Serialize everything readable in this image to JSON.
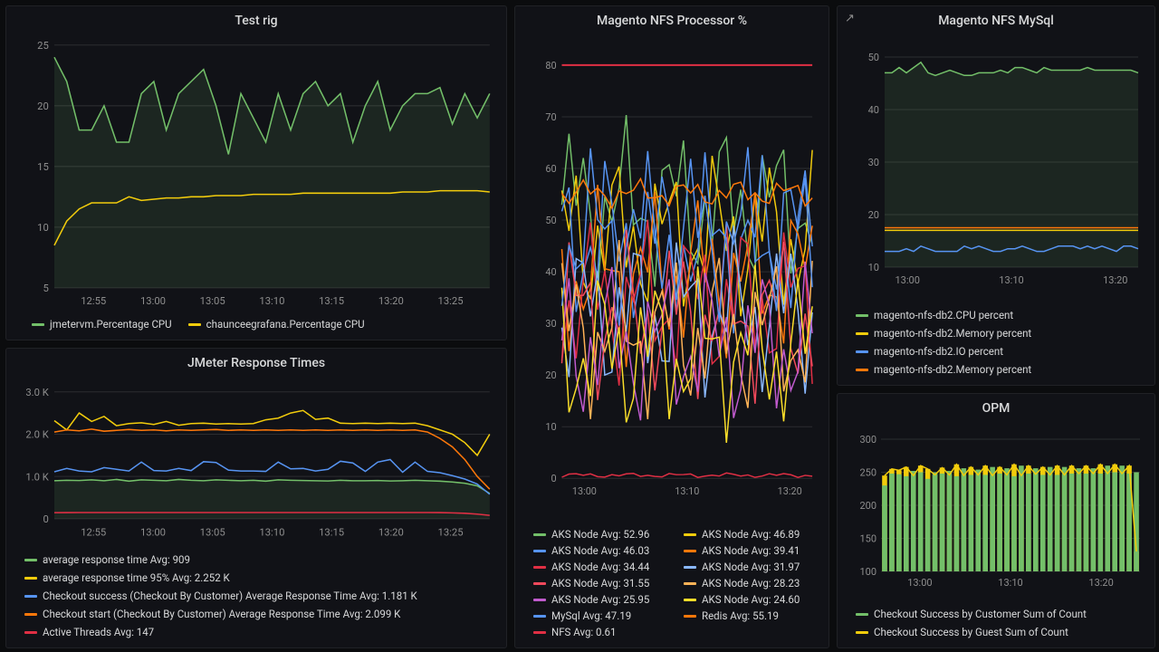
{
  "panels": {
    "testrig": {
      "title": "Test rig",
      "legend": [
        {
          "color": "#73bf69",
          "label": "jmetervm.Percentage CPU"
        },
        {
          "color": "#f2cc0c",
          "label": "chaunceegrafana.Percentage CPU"
        }
      ]
    },
    "jmeter": {
      "title": "JMeter Response Times",
      "legend": [
        {
          "color": "#73bf69",
          "label": "average response time  Avg: 909"
        },
        {
          "color": "#f2cc0c",
          "label": "average response time 95%  Avg: 2.252 K"
        },
        {
          "color": "#5794f2",
          "label": "Checkout success (Checkout By Customer) Average Response Time  Avg: 1.181 K"
        },
        {
          "color": "#ff780a",
          "label": "Checkout start (Checkout By Customer) Average Response Time  Avg: 2.099 K"
        },
        {
          "color": "#e02f44",
          "label": "Active Threads  Avg: 147"
        }
      ]
    },
    "nfsproc": {
      "title": "Magento NFS Processor %",
      "legend": [
        {
          "color": "#73bf69",
          "label": "AKS Node  Avg: 52.96"
        },
        {
          "color": "#f2cc0c",
          "label": "AKS Node  Avg: 46.89"
        },
        {
          "color": "#5794f2",
          "label": "AKS Node  Avg: 46.03"
        },
        {
          "color": "#ff780a",
          "label": "AKS Node  Avg: 39.41"
        },
        {
          "color": "#e02f44",
          "label": "AKS Node  Avg: 34.44"
        },
        {
          "color": "#8ab8ff",
          "label": "AKS Node  Avg: 31.97"
        },
        {
          "color": "#f2495c",
          "label": "AKS Node  Avg: 31.55"
        },
        {
          "color": "#ffb357",
          "label": "AKS Node  Avg: 28.23"
        },
        {
          "color": "#c15bce",
          "label": "AKS Node  Avg: 25.95"
        },
        {
          "color": "#fade2a",
          "label": "AKS Node  Avg: 24.60"
        },
        {
          "color": "#5794f2",
          "label": "MySql  Avg: 47.19"
        },
        {
          "color": "#ff780a",
          "label": "Redis  Avg: 55.19"
        },
        {
          "color": "#e02f44",
          "label": "NFS  Avg: 0.61"
        }
      ]
    },
    "mysql": {
      "title": "Magento NFS MySql",
      "legend": [
        {
          "color": "#73bf69",
          "label": "magento-nfs-db2.CPU percent"
        },
        {
          "color": "#f2cc0c",
          "label": "magento-nfs-db2.Memory percent"
        },
        {
          "color": "#5794f2",
          "label": "magento-nfs-db2.IO percent"
        },
        {
          "color": "#ff780a",
          "label": "magento-nfs-db2.Memory percent"
        }
      ]
    },
    "opm": {
      "title": "OPM",
      "legend": [
        {
          "color": "#73bf69",
          "label": "Checkout Success by Customer Sum of Count"
        },
        {
          "color": "#f2cc0c",
          "label": "Checkout Success by Guest Sum of Count"
        }
      ]
    }
  },
  "chart_data": [
    {
      "panel": "testrig",
      "type": "line",
      "x_ticks": [
        "12:55",
        "13:00",
        "13:05",
        "13:10",
        "13:15",
        "13:20",
        "13:25"
      ],
      "ylim": [
        5,
        25
      ],
      "y_ticks": [
        5,
        10,
        15,
        20,
        25
      ],
      "series": [
        {
          "name": "jmetervm.Percentage CPU",
          "color": "#73bf69",
          "x": [
            "12:50",
            "12:51",
            "12:52",
            "12:53",
            "12:54",
            "12:55",
            "12:56",
            "12:57",
            "12:58",
            "12:59",
            "13:00",
            "13:01",
            "13:02",
            "13:03",
            "13:04",
            "13:05",
            "13:06",
            "13:07",
            "13:08",
            "13:09",
            "13:10",
            "13:11",
            "13:12",
            "13:13",
            "13:14",
            "13:15",
            "13:16",
            "13:17",
            "13:18",
            "13:19",
            "13:20",
            "13:21",
            "13:22",
            "13:23",
            "13:24",
            "13:25"
          ],
          "y": [
            24,
            22,
            18,
            18,
            20,
            17,
            17,
            21,
            22,
            18,
            21,
            22,
            23,
            20,
            16,
            21,
            19,
            17,
            21,
            18,
            21,
            22,
            20,
            21,
            17,
            20,
            22,
            18,
            20,
            21,
            21,
            21.5,
            18.5,
            21,
            19,
            21
          ]
        },
        {
          "name": "chaunceegrafana.Percentage CPU",
          "color": "#f2cc0c",
          "x": [
            "12:50",
            "12:51",
            "12:52",
            "12:53",
            "12:54",
            "12:55",
            "12:56",
            "12:57",
            "12:58",
            "12:59",
            "13:00",
            "13:01",
            "13:02",
            "13:03",
            "13:04",
            "13:05",
            "13:06",
            "13:07",
            "13:08",
            "13:09",
            "13:10",
            "13:11",
            "13:12",
            "13:13",
            "13:14",
            "13:15",
            "13:16",
            "13:17",
            "13:18",
            "13:19",
            "13:20",
            "13:21",
            "13:22",
            "13:23",
            "13:24",
            "13:25"
          ],
          "y": [
            8.5,
            10.5,
            11.5,
            12,
            12,
            12,
            12.5,
            12.2,
            12.3,
            12.4,
            12.4,
            12.5,
            12.5,
            12.6,
            12.6,
            12.6,
            12.7,
            12.7,
            12.7,
            12.7,
            12.8,
            12.8,
            12.8,
            12.8,
            12.8,
            12.8,
            12.8,
            12.8,
            12.9,
            12.9,
            12.9,
            13,
            13,
            13,
            13,
            12.9
          ]
        }
      ]
    },
    {
      "panel": "jmeter",
      "type": "line",
      "x_ticks": [
        "12:55",
        "13:00",
        "13:05",
        "13:10",
        "13:15",
        "13:20",
        "13:25"
      ],
      "ylim": [
        0,
        3000
      ],
      "y_ticks_labels": [
        "0",
        "1.0 K",
        "2.0 K",
        "3.0 K"
      ],
      "y_ticks": [
        0,
        1000,
        2000,
        3000
      ],
      "series": [
        {
          "name": "average response time",
          "color": "#73bf69",
          "avg": 909,
          "y": [
            900,
            910,
            905,
            920,
            900,
            930,
            890,
            920,
            910,
            900,
            930,
            910,
            900,
            920,
            910,
            900,
            910,
            890,
            920,
            910,
            905,
            900,
            895,
            910,
            900,
            900,
            905,
            895,
            900,
            910,
            900,
            890,
            870,
            840,
            780,
            600
          ]
        },
        {
          "name": "average response time 95%",
          "color": "#f2cc0c",
          "avg": 2252,
          "y": [
            2320,
            2100,
            2500,
            2300,
            2420,
            2200,
            2250,
            2270,
            2230,
            2300,
            2210,
            2250,
            2260,
            2240,
            2250,
            2240,
            2250,
            2340,
            2380,
            2500,
            2560,
            2350,
            2380,
            2260,
            2250,
            2260,
            2250,
            2260,
            2250,
            2260,
            2200,
            2100,
            2000,
            1800,
            1500,
            2000
          ]
        },
        {
          "name": "Checkout success Average Response Time",
          "color": "#5794f2",
          "avg": 1181,
          "y": [
            1110,
            1190,
            1130,
            1110,
            1210,
            1170,
            1130,
            1340,
            1140,
            1130,
            1190,
            1140,
            1350,
            1330,
            1150,
            1130,
            1130,
            1120,
            1340,
            1180,
            1190,
            1130,
            1170,
            1360,
            1320,
            1120,
            1340,
            1400,
            1100,
            1340,
            1120,
            1090,
            1020,
            940,
            820,
            580
          ]
        },
        {
          "name": "Checkout start Average Response Time",
          "color": "#ff780a",
          "avg": 2099,
          "y": [
            2050,
            2100,
            2080,
            2120,
            2070,
            2090,
            2110,
            2090,
            2100,
            2080,
            2100,
            2090,
            2100,
            2110,
            2090,
            2100,
            2090,
            2100,
            2090,
            2100,
            2090,
            2100,
            2090,
            2100,
            2090,
            2100,
            2090,
            2100,
            2090,
            2100,
            2050,
            1900,
            1700,
            1400,
            1000,
            700
          ]
        },
        {
          "name": "Active Threads",
          "color": "#e02f44",
          "avg": 147,
          "y": [
            145,
            146,
            147,
            147,
            147,
            147,
            147,
            147,
            147,
            147,
            147,
            147,
            147,
            147,
            147,
            147,
            147,
            147,
            147,
            147,
            147,
            147,
            147,
            147,
            147,
            147,
            147,
            147,
            147,
            147,
            147,
            146,
            140,
            130,
            110,
            80
          ]
        }
      ]
    },
    {
      "panel": "nfsproc",
      "type": "line",
      "x_ticks": [
        "13:00",
        "13:10",
        "13:20"
      ],
      "ylim": [
        0,
        80
      ],
      "y_ticks": [
        0,
        10,
        20,
        30,
        40,
        50,
        60,
        70,
        80
      ],
      "series": [
        {
          "name": "AKS Node",
          "color": "#73bf69",
          "avg": 52.96
        },
        {
          "name": "AKS Node",
          "color": "#f2cc0c",
          "avg": 46.89
        },
        {
          "name": "AKS Node",
          "color": "#5794f2",
          "avg": 46.03
        },
        {
          "name": "AKS Node",
          "color": "#ff780a",
          "avg": 39.41
        },
        {
          "name": "AKS Node",
          "color": "#e02f44",
          "avg": 34.44
        },
        {
          "name": "AKS Node",
          "color": "#8ab8ff",
          "avg": 31.97
        },
        {
          "name": "AKS Node",
          "color": "#f2495c",
          "avg": 31.55
        },
        {
          "name": "AKS Node",
          "color": "#ffb357",
          "avg": 28.23
        },
        {
          "name": "AKS Node",
          "color": "#c15bce",
          "avg": 25.95
        },
        {
          "name": "AKS Node",
          "color": "#fade2a",
          "avg": 24.6
        },
        {
          "name": "MySql",
          "color": "#5794f2",
          "avg": 47.19
        },
        {
          "name": "Redis",
          "color": "#ff780a",
          "avg": 55.19
        },
        {
          "name": "NFS",
          "color": "#e02f44",
          "avg": 0.61
        }
      ]
    },
    {
      "panel": "mysql",
      "type": "line",
      "x_ticks": [
        "13:00",
        "13:10",
        "13:20"
      ],
      "ylim": [
        10,
        50
      ],
      "y_ticks": [
        10,
        20,
        30,
        40,
        50
      ],
      "series": [
        {
          "name": "CPU percent",
          "color": "#73bf69",
          "y": [
            47,
            47,
            48,
            47,
            48,
            49,
            47,
            46.5,
            47,
            47.5,
            47,
            46.5,
            46.5,
            47,
            47,
            47,
            47.5,
            47,
            48,
            48,
            47.5,
            47,
            48,
            47.5,
            47.5,
            47.5,
            47.5,
            47.5,
            48,
            47.5,
            47.5,
            47.5,
            47.5,
            47.5,
            47.5,
            47
          ]
        },
        {
          "name": "Memory percent",
          "color": "#f2cc0c",
          "y": [
            17,
            17,
            17,
            17,
            17,
            17,
            17,
            17,
            17,
            17,
            17,
            17,
            17,
            17,
            17,
            17,
            17,
            17,
            17,
            17,
            17,
            17,
            17,
            17,
            17,
            17,
            17,
            17,
            17,
            17,
            17,
            17,
            17,
            17,
            17,
            17
          ]
        },
        {
          "name": "IO percent",
          "color": "#5794f2",
          "y": [
            13,
            13,
            13,
            13.5,
            13,
            14,
            13.5,
            13,
            13,
            13,
            13,
            14,
            13.5,
            14,
            13.5,
            13,
            13,
            13.5,
            13.5,
            14,
            13.5,
            13,
            13,
            13.5,
            14,
            14,
            14,
            13.5,
            14,
            13.5,
            14,
            13.5,
            13,
            14,
            14,
            13.5
          ]
        },
        {
          "name": "Memory percent 2",
          "color": "#ff780a",
          "y": [
            17.5,
            17.5,
            17.5,
            17.5,
            17.5,
            17.5,
            17.5,
            17.5,
            17.5,
            17.5,
            17.5,
            17.5,
            17.5,
            17.5,
            17.5,
            17.5,
            17.5,
            17.5,
            17.5,
            17.5,
            17.5,
            17.5,
            17.5,
            17.5,
            17.5,
            17.5,
            17.5,
            17.5,
            17.5,
            17.5,
            17.5,
            17.5,
            17.5,
            17.5,
            17.5,
            17.5
          ]
        }
      ]
    },
    {
      "panel": "opm",
      "type": "bar",
      "x_ticks": [
        "13:00",
        "13:10",
        "13:20"
      ],
      "ylim": [
        100,
        300
      ],
      "y_ticks": [
        100,
        150,
        200,
        250,
        300
      ],
      "series": [
        {
          "name": "Checkout Success by Customer",
          "color": "#73bf69",
          "y": [
            230,
            248,
            247,
            244,
            252,
            250,
            240,
            250,
            248,
            252,
            244,
            256,
            246,
            254,
            246,
            258,
            248,
            256,
            244,
            260,
            248,
            256,
            246,
            258,
            246,
            258,
            248,
            256,
            248,
            256,
            248,
            260,
            250,
            260,
            248,
            250
          ]
        },
        {
          "name": "Checkout Success by Guest",
          "color": "#f2cc0c",
          "y": [
            245,
            255,
            253,
            258,
            245,
            260,
            255,
            246,
            257,
            246,
            262,
            245,
            258,
            246,
            260,
            245,
            258,
            246,
            262,
            245,
            260,
            247,
            258,
            246,
            260,
            246,
            260,
            248,
            260,
            248,
            262,
            248,
            262,
            248,
            260,
            130
          ]
        }
      ]
    }
  ]
}
